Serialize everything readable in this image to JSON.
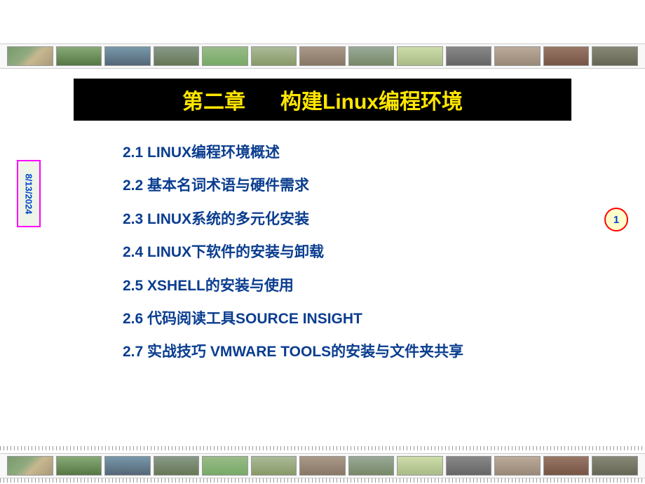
{
  "header": {
    "chapter_label": "第二章",
    "chapter_title": "构建Linux编程环境"
  },
  "date": "8/13/2024",
  "page_number": "1",
  "toc": [
    "2.1 LINUX编程环境概述",
    "2.2 基本名词术语与硬件需求",
    "2.3  LINUX系统的多元化安装",
    "2.4 LINUX下软件的安装与卸载",
    "2.5 XSHELL的安装与使用",
    "2.6 代码阅读工具SOURCE INSIGHT",
    "2.7 实战技巧 VMWARE TOOLS的安装与文件夹共享"
  ]
}
